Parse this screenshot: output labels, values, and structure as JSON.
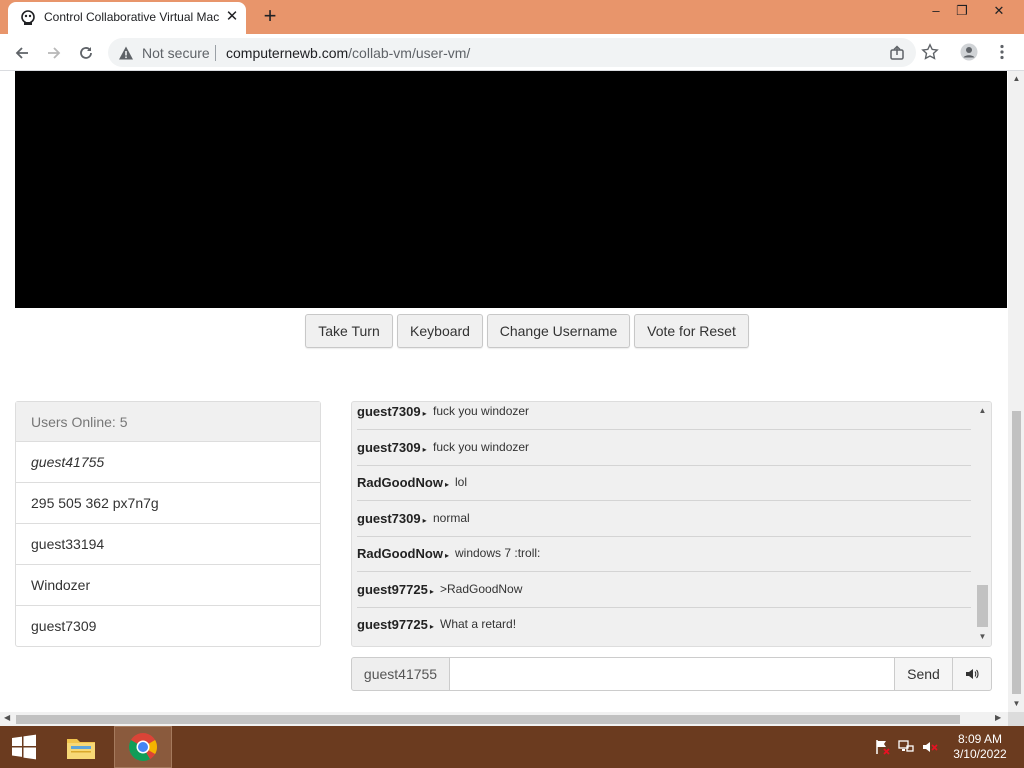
{
  "browser": {
    "tab_title": "Control Collaborative Virtual Machines",
    "security_label": "Not secure",
    "url_host": "computernewb.com",
    "url_path": "/collab-vm/user-vm/"
  },
  "vm": {
    "buttons": [
      "Take Turn",
      "Keyboard",
      "Change Username",
      "Vote for Reset"
    ]
  },
  "users": {
    "header": "Users Online: 5",
    "list": [
      "guest41755",
      "295 505 362 px7n7g",
      "guest33194",
      "Windozer",
      "guest7309"
    ]
  },
  "chat": {
    "messages": [
      {
        "nick": "guest7309",
        "text": "fuck you windozer"
      },
      {
        "nick": "guest7309",
        "text": "fuck you windozer"
      },
      {
        "nick": "RadGoodNow",
        "text": "lol"
      },
      {
        "nick": "guest7309",
        "text": "normal"
      },
      {
        "nick": "RadGoodNow",
        "text": "windows 7 :troll:"
      },
      {
        "nick": "guest97725",
        "text": ">RadGoodNow"
      },
      {
        "nick": "guest97725",
        "text": "What a retard!"
      }
    ],
    "username": "guest41755",
    "input_value": "",
    "send_label": "Send"
  },
  "taskbar": {
    "time": "8:09 AM",
    "date": "3/10/2022"
  },
  "colors": {
    "titlebar": "#e8956b",
    "taskbar": "#6b3b1f"
  }
}
